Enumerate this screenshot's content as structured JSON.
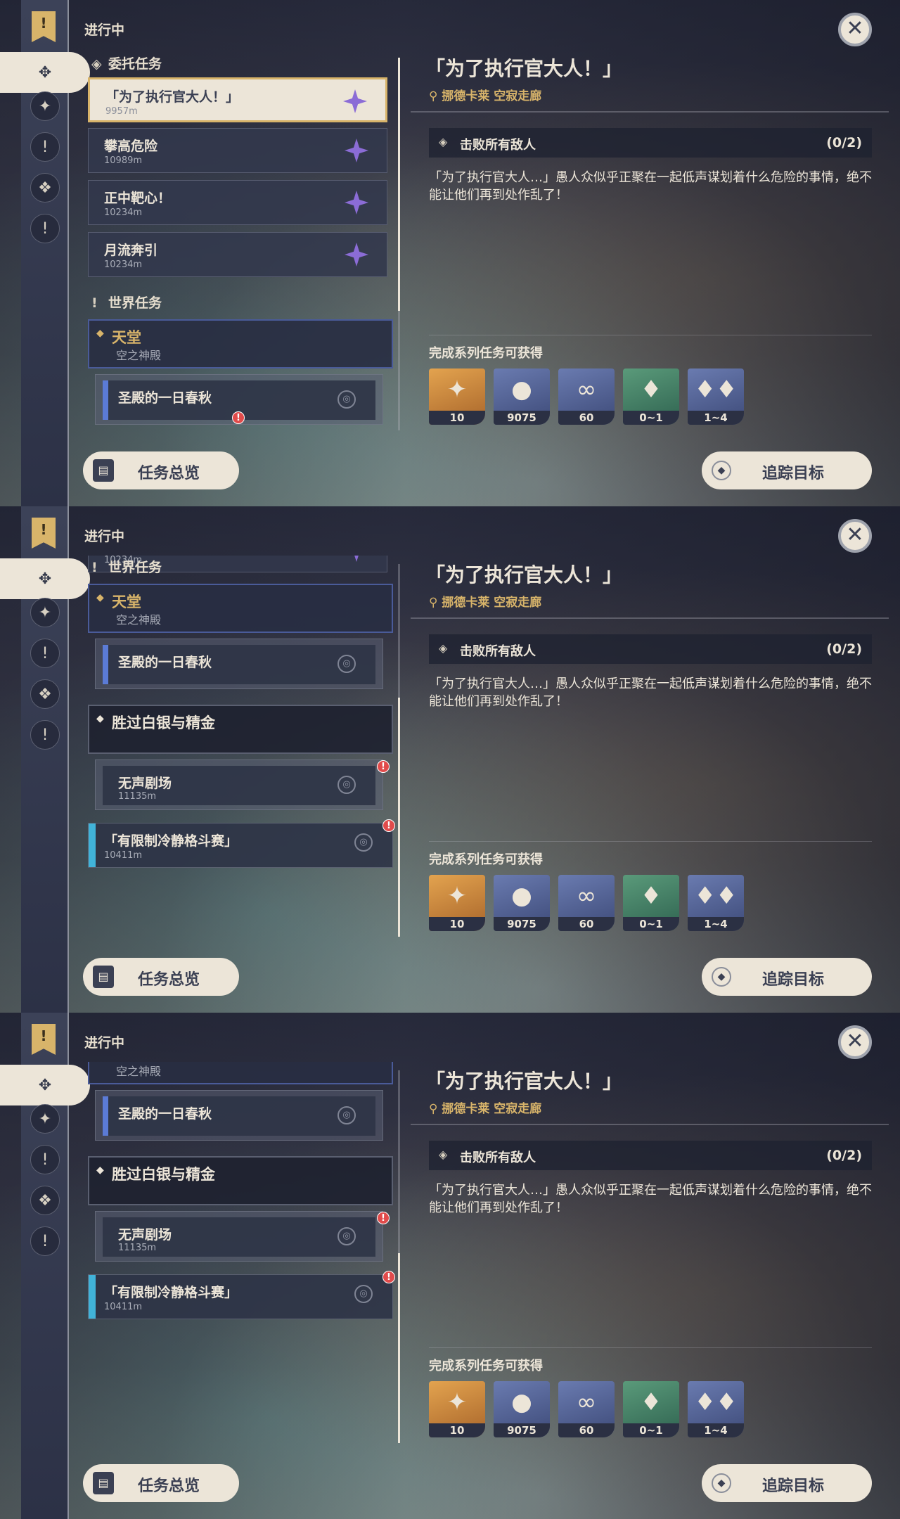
{
  "header": {
    "in_progress": "进行中",
    "close_symbol": "✕"
  },
  "sidebar": {
    "bookmark_symbol": "!",
    "icons": [
      "commission-icon",
      "archon-icon",
      "world-quest-icon",
      "event-quest-icon",
      "story-quest-icon"
    ]
  },
  "commission": {
    "section_label": "委托任务",
    "items": [
      {
        "title": "「为了执行官大人！」",
        "distance": "9957m"
      },
      {
        "title": "攀高危险",
        "distance": "10989m"
      },
      {
        "title": "正中靶心！",
        "distance": "10234m"
      },
      {
        "title": "月流奔引",
        "distance": "10234m"
      }
    ]
  },
  "world": {
    "section_label": "世界任务",
    "chapter1": {
      "title": "天堂",
      "subtitle": "空之神殿"
    },
    "chapter1_item": {
      "title": "圣殿的一日春秋"
    },
    "chapter2": {
      "title": "胜过白银与精金"
    },
    "chapter2_item": {
      "title": "无声剧场",
      "distance": "11135m"
    },
    "item3": {
      "title": "「有限制冷静格斗赛」",
      "distance": "10411m"
    },
    "partial_distance": "10234m"
  },
  "detail": {
    "title": "「为了执行官大人！」",
    "location": "挪德卡莱 空寂走廊",
    "objective": "击败所有敌人",
    "progress": "(0/2)",
    "description": "「为了执行官大人…」愚人众似乎正聚在一起低声谋划着什么危险的事情，绝不能让他们再到处作乱了！",
    "rewards_label": "完成系列任务可获得",
    "rewards": [
      {
        "icon": "primogem-icon",
        "count": "10"
      },
      {
        "icon": "mora-icon",
        "count": "9075"
      },
      {
        "icon": "exp-icon",
        "count": "60"
      },
      {
        "icon": "crystal-icon",
        "count": "0~1"
      },
      {
        "icon": "crystal-cluster-icon",
        "count": "1~4"
      }
    ]
  },
  "footer": {
    "overview_label": "任务总览",
    "track_label": "追踪目标"
  }
}
